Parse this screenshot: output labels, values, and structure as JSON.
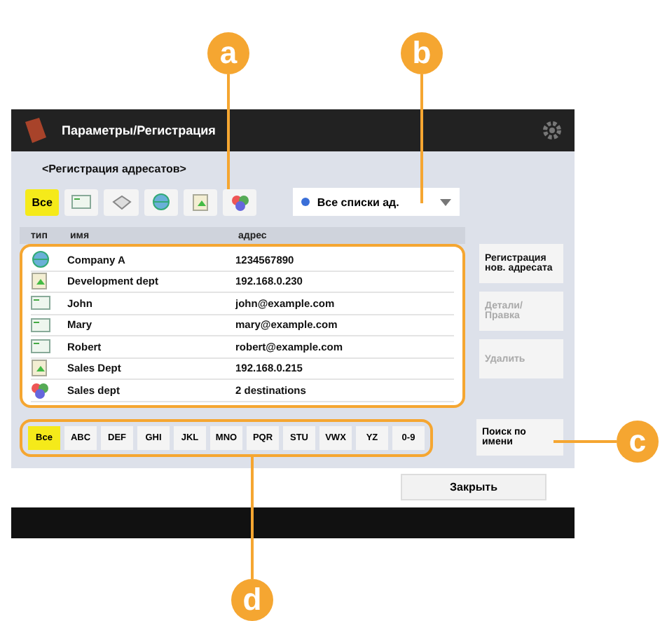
{
  "window": {
    "title": "Параметры/Регистрация"
  },
  "subtitle": "<Регистрация адресатов>",
  "type_filters": [
    {
      "kind": "all",
      "label": "Все",
      "selected": true
    },
    {
      "kind": "email",
      "selected": false
    },
    {
      "kind": "fax",
      "selected": false
    },
    {
      "kind": "ifax",
      "selected": false
    },
    {
      "kind": "file",
      "selected": false
    },
    {
      "kind": "group",
      "selected": false
    }
  ],
  "address_list_dropdown": {
    "value": "Все списки ад."
  },
  "table": {
    "columns": [
      "тип",
      "имя",
      "адрес"
    ],
    "rows": [
      {
        "kind": "ifax",
        "name": "Company A",
        "address": "1234567890"
      },
      {
        "kind": "file",
        "name": "Development dept",
        "address": "192.168.0.230"
      },
      {
        "kind": "email",
        "name": "John",
        "address": "john@example.com"
      },
      {
        "kind": "email",
        "name": "Mary",
        "address": "mary@example.com"
      },
      {
        "kind": "email",
        "name": "Robert",
        "address": "robert@example.com"
      },
      {
        "kind": "file",
        "name": "Sales Dept",
        "address": "192.168.0.215"
      },
      {
        "kind": "group",
        "name": "Sales dept",
        "address": "2 destinations"
      }
    ]
  },
  "side_buttons": [
    {
      "label": "Регистрация нов. адресата",
      "disabled": false
    },
    {
      "label": "Детали/ Правка",
      "disabled": true
    },
    {
      "label": "Удалить",
      "disabled": true
    }
  ],
  "search_button": {
    "label": "Поиск по имени"
  },
  "letter_tabs": [
    {
      "label": "Все",
      "selected": true
    },
    {
      "label": "ABC",
      "selected": false
    },
    {
      "label": "DEF",
      "selected": false
    },
    {
      "label": "GHI",
      "selected": false
    },
    {
      "label": "JKL",
      "selected": false
    },
    {
      "label": "MNO",
      "selected": false
    },
    {
      "label": "PQR",
      "selected": false
    },
    {
      "label": "STU",
      "selected": false
    },
    {
      "label": "VWX",
      "selected": false
    },
    {
      "label": "YZ",
      "selected": false
    },
    {
      "label": "0-9",
      "selected": false
    }
  ],
  "close_button": {
    "label": "Закрыть"
  },
  "callouts": [
    {
      "label": "a"
    },
    {
      "label": "b"
    },
    {
      "label": "c"
    },
    {
      "label": "d"
    }
  ]
}
